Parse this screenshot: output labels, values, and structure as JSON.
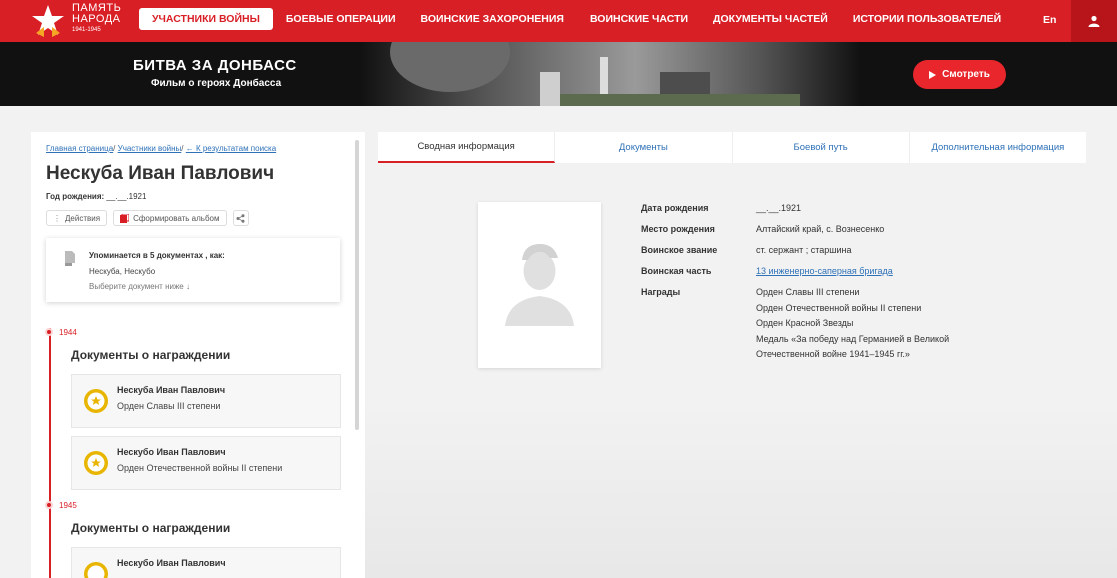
{
  "header": {
    "logo": {
      "line1": "ПАМЯТЬ",
      "line2": "НАРОДА",
      "line3": "1941-1945"
    },
    "nav": [
      {
        "label": "Участники войны",
        "active": true
      },
      {
        "label": "Боевые операции",
        "active": false
      },
      {
        "label": "Воинские захоронения",
        "active": false
      },
      {
        "label": "Воинские части",
        "active": false
      },
      {
        "label": "Документы частей",
        "active": false
      },
      {
        "label": "Истории пользователей",
        "active": false
      }
    ],
    "lang": "En",
    "user_icon": "user-icon"
  },
  "banner": {
    "title": "БИТВА ЗА ДОНБАСС",
    "subtitle": "Фильм о героях Донбасса",
    "button": "Смотреть"
  },
  "breadcrumb": {
    "home": "Главная страница",
    "section": "Участники войны",
    "back": "← К результатам поиска"
  },
  "person": {
    "name": "Нескуба Иван Павлович",
    "birth_label": "Год рождения:",
    "birth_value": "__.__.1921"
  },
  "actions": {
    "actions_label": "Действия",
    "album_label": "Сформировать альбом"
  },
  "mention": {
    "title": "Упоминается в 5 документах , как:",
    "names": "Нескуба, Нескубо",
    "hint": "Выберите документ ниже ↓"
  },
  "timeline": [
    {
      "year": "1944",
      "heading": "Документы о награждении",
      "items": [
        {
          "name": "Нескуба Иван Павлович",
          "award": "Орден Славы III степени"
        },
        {
          "name": "Нескубо Иван Павлович",
          "award": "Орден Отечественной войны II степени"
        }
      ]
    },
    {
      "year": "1945",
      "heading": "Документы о награждении",
      "items": [
        {
          "name": "Нескубо Иван Павлович",
          "award": ""
        }
      ]
    }
  ],
  "tabs": [
    {
      "label": "Сводная информация",
      "active": true
    },
    {
      "label": "Документы",
      "active": false
    },
    {
      "label": "Боевой путь",
      "active": false
    },
    {
      "label": "Дополнительная информация",
      "active": false
    }
  ],
  "info": {
    "birth_date": {
      "label": "Дата рождения",
      "value": "__.__.1921"
    },
    "birth_place": {
      "label": "Место рождения",
      "value": "Алтайский край, с. Вознесенко"
    },
    "rank": {
      "label": "Воинское звание",
      "value": "ст. сержант ; старшина"
    },
    "unit": {
      "label": "Воинская часть",
      "value": "13 инженерно-саперная бригада"
    },
    "awards": {
      "label": "Награды",
      "values": [
        "Орден Славы III степени",
        "Орден Отечественной войны II степени",
        "Орден Красной Звезды",
        "Медаль «За победу над Германией в Великой",
        "Отечественной войне 1941–1945 гг.»"
      ]
    }
  },
  "colors": {
    "brand_red": "#d91f26",
    "link_blue": "#2f72b8"
  }
}
